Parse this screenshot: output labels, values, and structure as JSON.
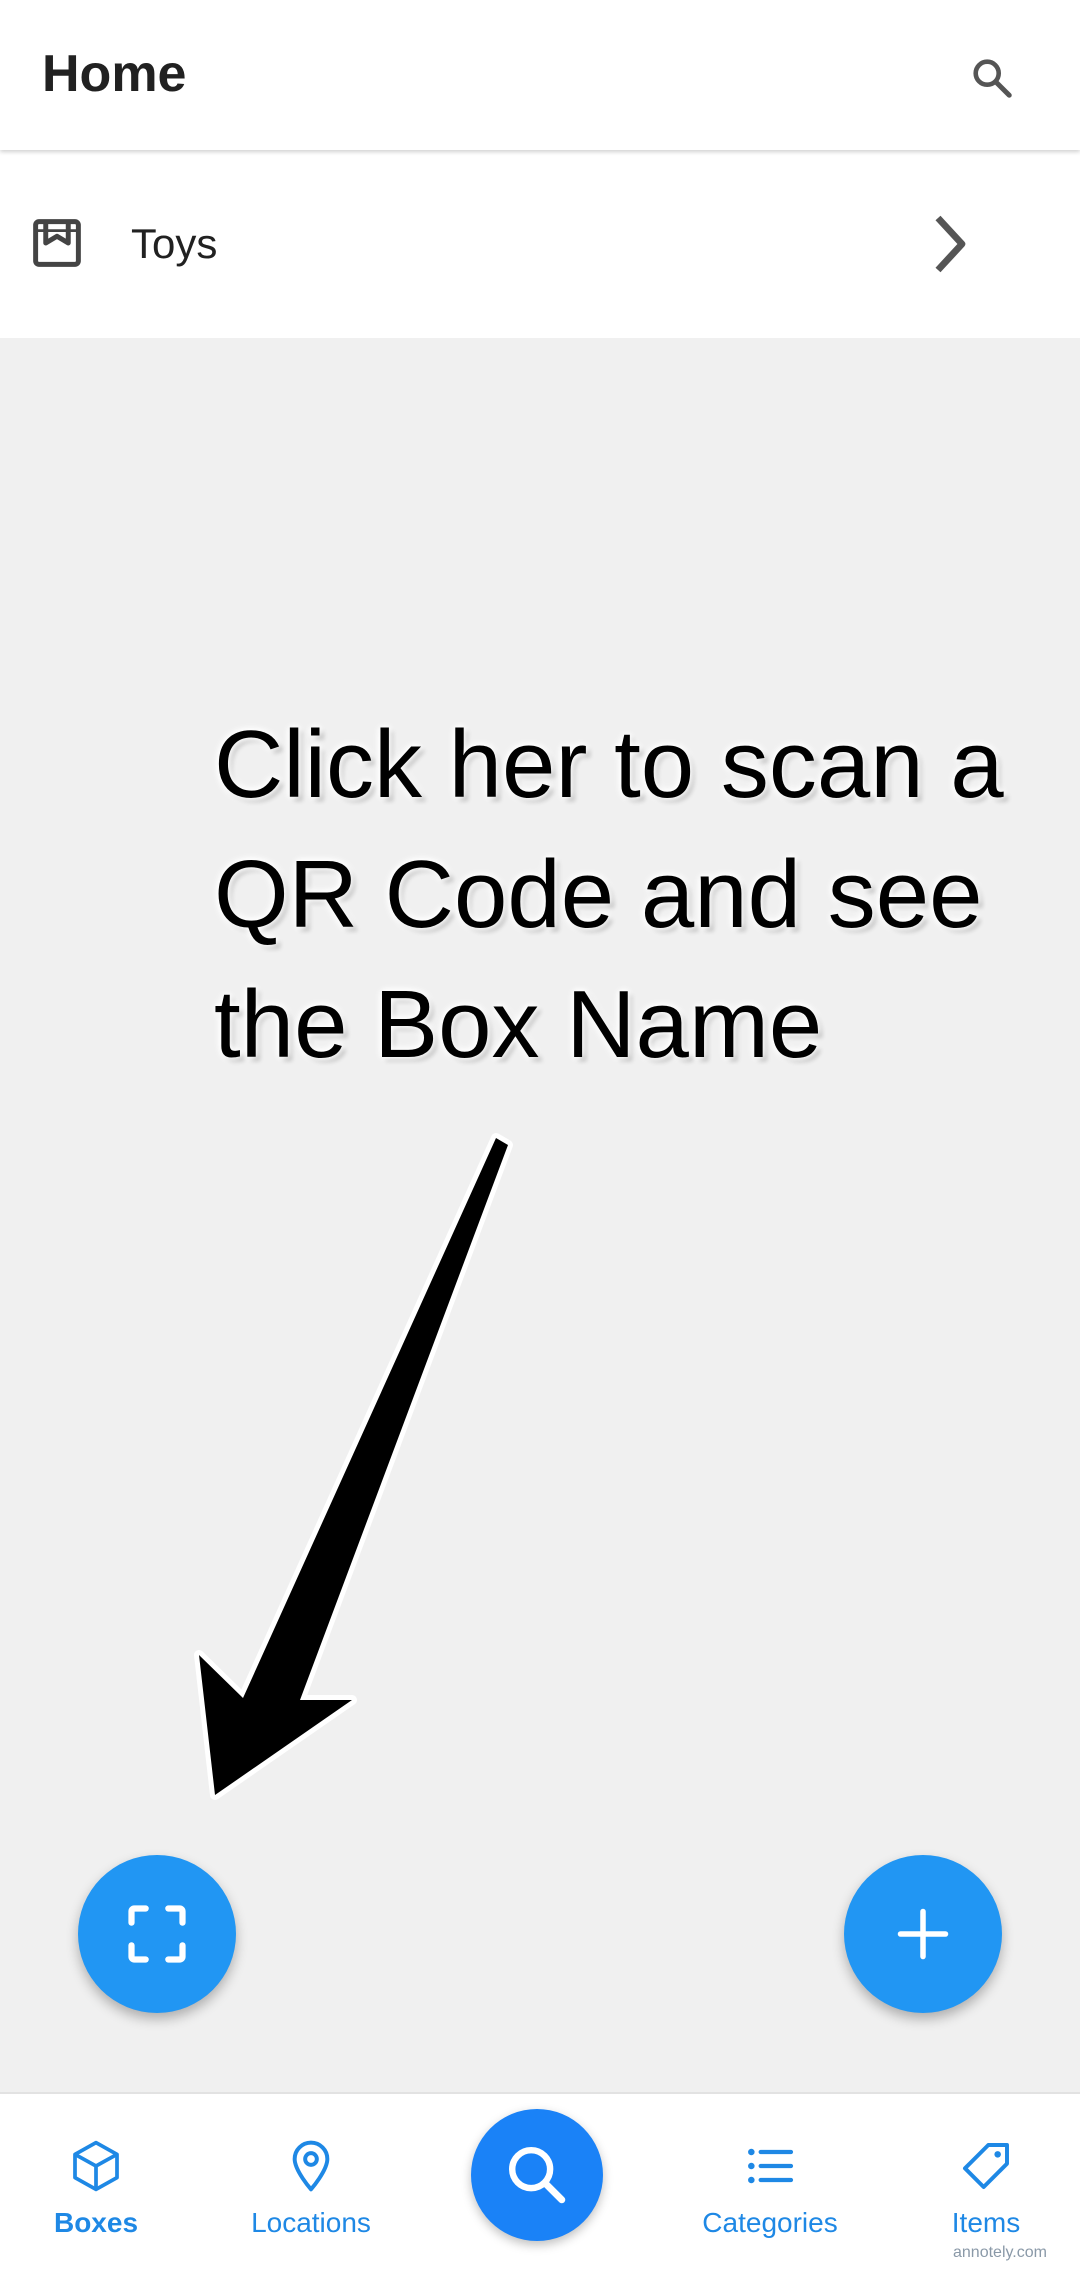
{
  "appbar": {
    "title": "Home",
    "search_icon": "search-icon"
  },
  "list": {
    "items": [
      {
        "label": "Toys",
        "icon": "box-icon"
      }
    ]
  },
  "annotation": {
    "lines": [
      "Click her to scan a",
      "QR Code and see",
      "the Box Name"
    ]
  },
  "fabs": {
    "scan_icon": "scan-icon",
    "add_icon": "plus-icon"
  },
  "bottom_nav": {
    "items": [
      {
        "label": "Boxes",
        "icon": "cube-icon",
        "active": true
      },
      {
        "label": "Locations",
        "icon": "location-pin-icon"
      },
      {
        "label": "Categories",
        "icon": "list-icon"
      },
      {
        "label": "Items",
        "icon": "tag-icon"
      }
    ],
    "center_icon": "search-icon"
  },
  "watermark": "annotely.com",
  "colors": {
    "accent": "#2196f3",
    "nav_text": "#1e88e5",
    "background": "#f0f0f0"
  }
}
